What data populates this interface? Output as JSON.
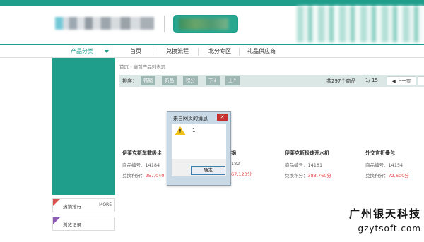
{
  "nav": {
    "category_label": "产品分类",
    "items": [
      "首页",
      "兑换流程",
      "北分专区",
      "礼品供应商"
    ]
  },
  "sidebar": {
    "hot_label": "热销排行",
    "more_label": "MORE",
    "history_label": "浏览记录"
  },
  "breadcrumb": "首页 › 当前产品列表页",
  "toolbar": {
    "sort_label": "排序：",
    "buttons": [
      "畅销",
      "新品",
      "积分",
      "下↓",
      "上↑"
    ],
    "total": "共297个商品",
    "page": "1/ 15",
    "prev": "◀ 上一页"
  },
  "products": [
    {
      "name": "伊莱克斯车载吸尘",
      "code": "商品编号：14184",
      "points_label": "兑换积分：",
      "points": "257,040"
    },
    {
      "name": "锅",
      "code": "182",
      "points_label": "",
      "points": "67,120分"
    },
    {
      "name": "伊莱克斯极速开水机",
      "code": "商品编号：14181",
      "points_label": "兑换积分：",
      "points": "383,760分"
    },
    {
      "name": "外交官折叠包",
      "code": "商品编号：14154",
      "points_label": "兑换积分：",
      "points": "72,600分"
    }
  ],
  "dialog": {
    "title": "来自网页的消息",
    "close": "✕",
    "message": "1",
    "ok": "确定"
  },
  "watermark": {
    "line1": "广州银天科技",
    "line2": "gzytsoft.com"
  },
  "colors": {
    "brand": "#1f9e8c",
    "points_value": "#e23b3b",
    "dialog_close": "#c4302b"
  }
}
